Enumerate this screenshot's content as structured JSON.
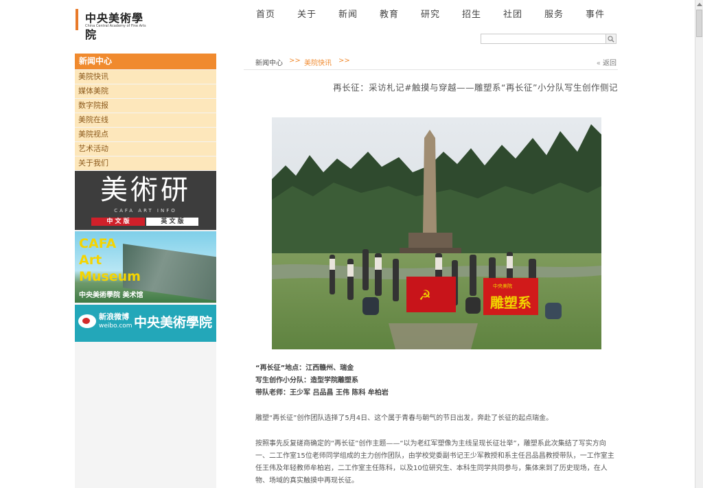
{
  "header": {
    "logo_cn": "中央美術學院",
    "logo_en": "China Central Academy of Fine Arts",
    "nav": [
      "首页",
      "关于",
      "新闻",
      "教育",
      "研究",
      "招生",
      "社团",
      "服务",
      "事件"
    ],
    "search_placeholder": ""
  },
  "sidebar": {
    "title": "新闻中心",
    "items": [
      "美院快讯",
      "媒体美院",
      "数字院报",
      "美院在线",
      "美院视点",
      "艺术活动",
      "关于我们"
    ],
    "banner_art_info": {
      "title": "美術研",
      "subtitle": "CAFA ART INFO",
      "lang_zh": "中 文 版",
      "lang_en": "英 文 版"
    },
    "banner_museum": {
      "lines": [
        "CAFA",
        "Art",
        "Museum"
      ],
      "sub": "中央美術學院 美术馆"
    },
    "banner_weibo": {
      "label": "新浪微博",
      "domain": "weibo.com",
      "cn": "中央美術學院"
    }
  },
  "breadcrumb": {
    "home": "新闻中心",
    "sep": ">>",
    "current": "美院快讯",
    "back": "返回"
  },
  "article": {
    "title": "再长征：采访札记#触摸与穿越——雕塑系“再长征”小分队写生创作侧记",
    "photo_flags": {
      "left_flag_text": "",
      "right_flag_top": "中央美院",
      "right_flag_main": "雕塑系"
    },
    "meta": [
      "“再长征”地点：江西赣州、瑞金",
      "写生创作小分队：造型学院雕塑系",
      "带队老师：王少军  吕品昌  王伟  陈科  牟柏岩"
    ],
    "para1": "雕塑“再长征”创作团队选择了5月4日、这个属于青春与朝气的节日出发，奔赴了长征的起点瑞金。",
    "para2": "按照事先反复磋商确定的“再长征”创作主题——“以为老红军塑像为主线呈现长征壮举”，雕塑系此次集结了写实方向一、二工作室15位老师同学组成的主力创作团队，由学校党委副书记王少军教授和系主任吕品昌教授带队，一工作室主任王伟及年轻教师牟柏岩，二工作室主任陈科，以及10位研究生、本科生同学共同参与，集体来到了历史现场，在人物、场域的真实触摸中再现长征。"
  }
}
